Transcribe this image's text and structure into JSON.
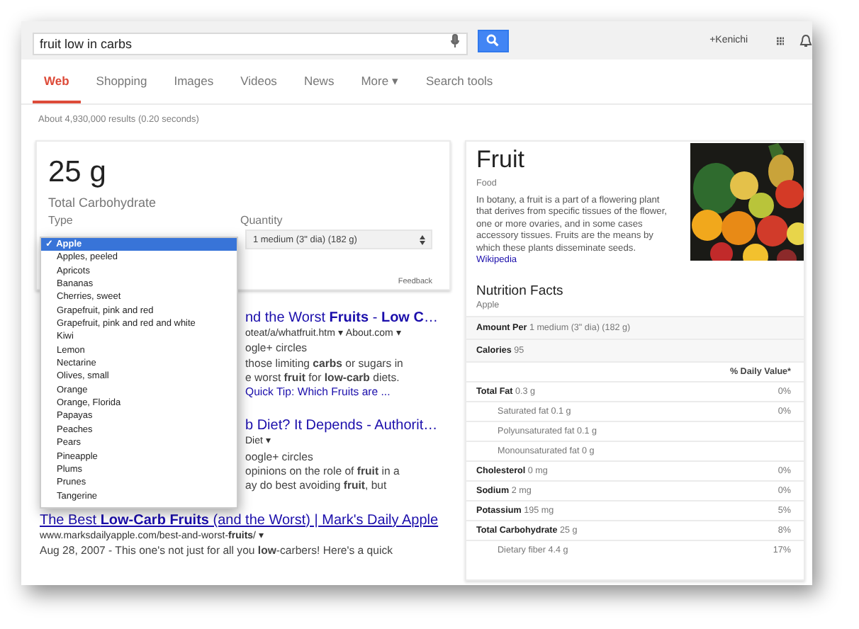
{
  "search": {
    "value": "fruit low in carbs"
  },
  "account": {
    "name": "+Kenichi"
  },
  "tabs": [
    {
      "label": "Web",
      "selected": true
    },
    {
      "label": "Shopping",
      "selected": false
    },
    {
      "label": "Images",
      "selected": false
    },
    {
      "label": "Videos",
      "selected": false
    },
    {
      "label": "News",
      "selected": false
    },
    {
      "label": "More ▾",
      "selected": false
    },
    {
      "label": "Search tools",
      "selected": false
    }
  ],
  "result_stats": "About 4,930,000 results (0.20 seconds)",
  "calculator": {
    "amount": "25 g",
    "nutrient": "Total Carbohydrate",
    "type_label": "Type",
    "quantity_label": "Quantity",
    "quantity": "1 medium (3\" dia) (182 g)",
    "feedback": "Feedback",
    "check_mark": "✓",
    "type_options": [
      {
        "label": "Apple",
        "selected": true
      },
      {
        "label": "Apples, peeled",
        "selected": false
      },
      {
        "label": "Apricots",
        "selected": false
      },
      {
        "label": "Bananas",
        "selected": false
      },
      {
        "label": "Cherries, sweet",
        "selected": false
      },
      {
        "label": "Grapefruit, pink and red",
        "selected": false
      },
      {
        "label": "Grapefruit, pink and red and white",
        "selected": false
      },
      {
        "label": "Kiwi",
        "selected": false
      },
      {
        "label": "Lemon",
        "selected": false
      },
      {
        "label": "Nectarine",
        "selected": false
      },
      {
        "label": "Olives, small",
        "selected": false
      },
      {
        "label": "Orange",
        "selected": false
      },
      {
        "label": "Orange, Florida",
        "selected": false
      },
      {
        "label": "Papayas",
        "selected": false
      },
      {
        "label": "Peaches",
        "selected": false
      },
      {
        "label": "Pears",
        "selected": false
      },
      {
        "label": "Pineapple",
        "selected": false
      },
      {
        "label": "Plums",
        "selected": false
      },
      {
        "label": "Prunes",
        "selected": false
      },
      {
        "label": "Tangerine",
        "selected": false
      }
    ]
  },
  "results": [
    {
      "title": "nd the Worst **Fruits** - **Low C**…",
      "lines": [
        {
          "kind": "url",
          "text": "oteat/a/whatfruit.htm ▾ About.com ▾"
        },
        {
          "kind": "text",
          "text": "ogle+ circles"
        },
        {
          "kind": "text",
          "text": "those limiting **carbs** or sugars in"
        },
        {
          "kind": "text",
          "text": "e worst **fruit** for **low-carb** diets."
        },
        {
          "kind": "link",
          "text": "Quick Tip: Which Fruits are ..."
        }
      ],
      "covered": true
    },
    {
      "title": "b Diet? It Depends - Authorit…",
      "lines": [
        {
          "kind": "url",
          "text": "Diet ▾"
        },
        {
          "kind": "text",
          "text": "oogle+ circles"
        },
        {
          "kind": "text",
          "text": "opinions on the role of **fruit** in a"
        },
        {
          "kind": "text",
          "text": "ay do best avoiding **fruit**, but"
        }
      ],
      "covered": true
    },
    {
      "title": "The Best **Low-Carb Fruits** (and the Worst) | Mark's Daily Apple",
      "lines": [
        {
          "kind": "url",
          "text": "www.marksdailyapple.com/best-and-worst-**fruits**/ ▾"
        },
        {
          "kind": "text",
          "text": "Aug 28, 2007 - This one's not just for all you **low**-carbers! Here's a quick"
        }
      ],
      "covered": false
    }
  ],
  "knowledge": {
    "title": "Fruit",
    "subtitle": "Food",
    "description": "In botany, a fruit is a part of a flowering plant that derives from specific tissues of the flower, one or more ovaries, and in some cases accessory tissues. Fruits are the means by which these plants disseminate seeds.",
    "source": "Wikipedia",
    "nutrition_title": "Nutrition Facts",
    "nutrition_item": "Apple",
    "rows": [
      {
        "kind": "shaded",
        "label": "Amount Per",
        "value": "1 medium (3\" dia) (182 g)"
      },
      {
        "kind": "shaded",
        "label": "Calories",
        "value": "95"
      },
      {
        "kind": "header",
        "dv": "% Daily Value*"
      },
      {
        "kind": "main",
        "label": "Total Fat",
        "value": "0.3 g",
        "dv": "0%"
      },
      {
        "kind": "sub",
        "value": "Saturated fat 0.1 g",
        "dv": "0%"
      },
      {
        "kind": "sub",
        "value": "Polyunsaturated fat 0.1 g"
      },
      {
        "kind": "sub",
        "value": "Monounsaturated fat 0 g"
      },
      {
        "kind": "main",
        "label": "Cholesterol",
        "value": "0 mg",
        "dv": "0%"
      },
      {
        "kind": "main",
        "label": "Sodium",
        "value": "2 mg",
        "dv": "0%"
      },
      {
        "kind": "main",
        "label": "Potassium",
        "value": "195 mg",
        "dv": "5%"
      },
      {
        "kind": "main",
        "label": "Total Carbohydrate",
        "value": "25 g",
        "dv": "8%"
      },
      {
        "kind": "sub",
        "value": "Dietary fiber 4.4 g",
        "dv": "17%"
      }
    ]
  }
}
